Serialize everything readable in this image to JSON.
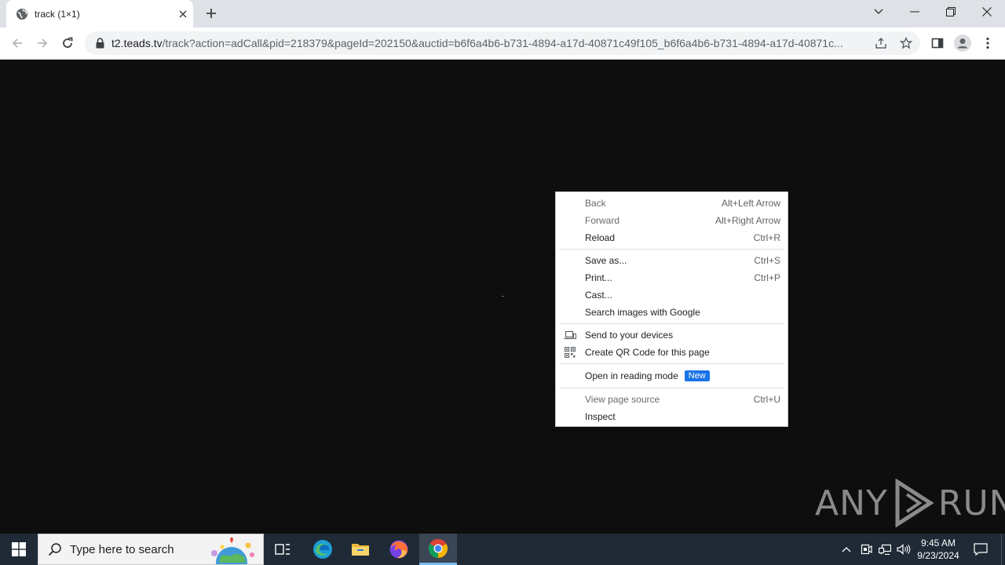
{
  "browser": {
    "tab": {
      "title": "track (1×1)"
    },
    "address": {
      "host": "t2.teads.tv",
      "path": "/track?action=adCall&pid=218379&pageId=202150&auctid=b6f6a4b6-b731-4894-a17d-40871c49f105_b6f6a4b6-b731-4894-a17d-40871c..."
    }
  },
  "context_menu": {
    "groups": [
      [
        {
          "label": "Back",
          "shortcut": "Alt+Left Arrow",
          "disabled": true
        },
        {
          "label": "Forward",
          "shortcut": "Alt+Right Arrow",
          "disabled": true
        },
        {
          "label": "Reload",
          "shortcut": "Ctrl+R"
        }
      ],
      [
        {
          "label": "Save as...",
          "shortcut": "Ctrl+S"
        },
        {
          "label": "Print...",
          "shortcut": "Ctrl+P"
        },
        {
          "label": "Cast...",
          "shortcut": ""
        },
        {
          "label": "Search images with Google",
          "shortcut": ""
        }
      ],
      [
        {
          "label": "Send to your devices",
          "icon": "devices-icon"
        },
        {
          "label": "Create QR Code for this page",
          "icon": "qr-code-icon"
        }
      ],
      [
        {
          "label": "Open in reading mode",
          "badge": "New"
        }
      ],
      [
        {
          "label": "View page source",
          "shortcut": "Ctrl+U",
          "disabled": true
        },
        {
          "label": "Inspect",
          "shortcut": ""
        }
      ]
    ]
  },
  "watermark": {
    "left": "ANY",
    "right": "RUN"
  },
  "taskbar": {
    "search_placeholder": "Type here to search",
    "time": "9:45 AM",
    "date": "9/23/2024"
  }
}
